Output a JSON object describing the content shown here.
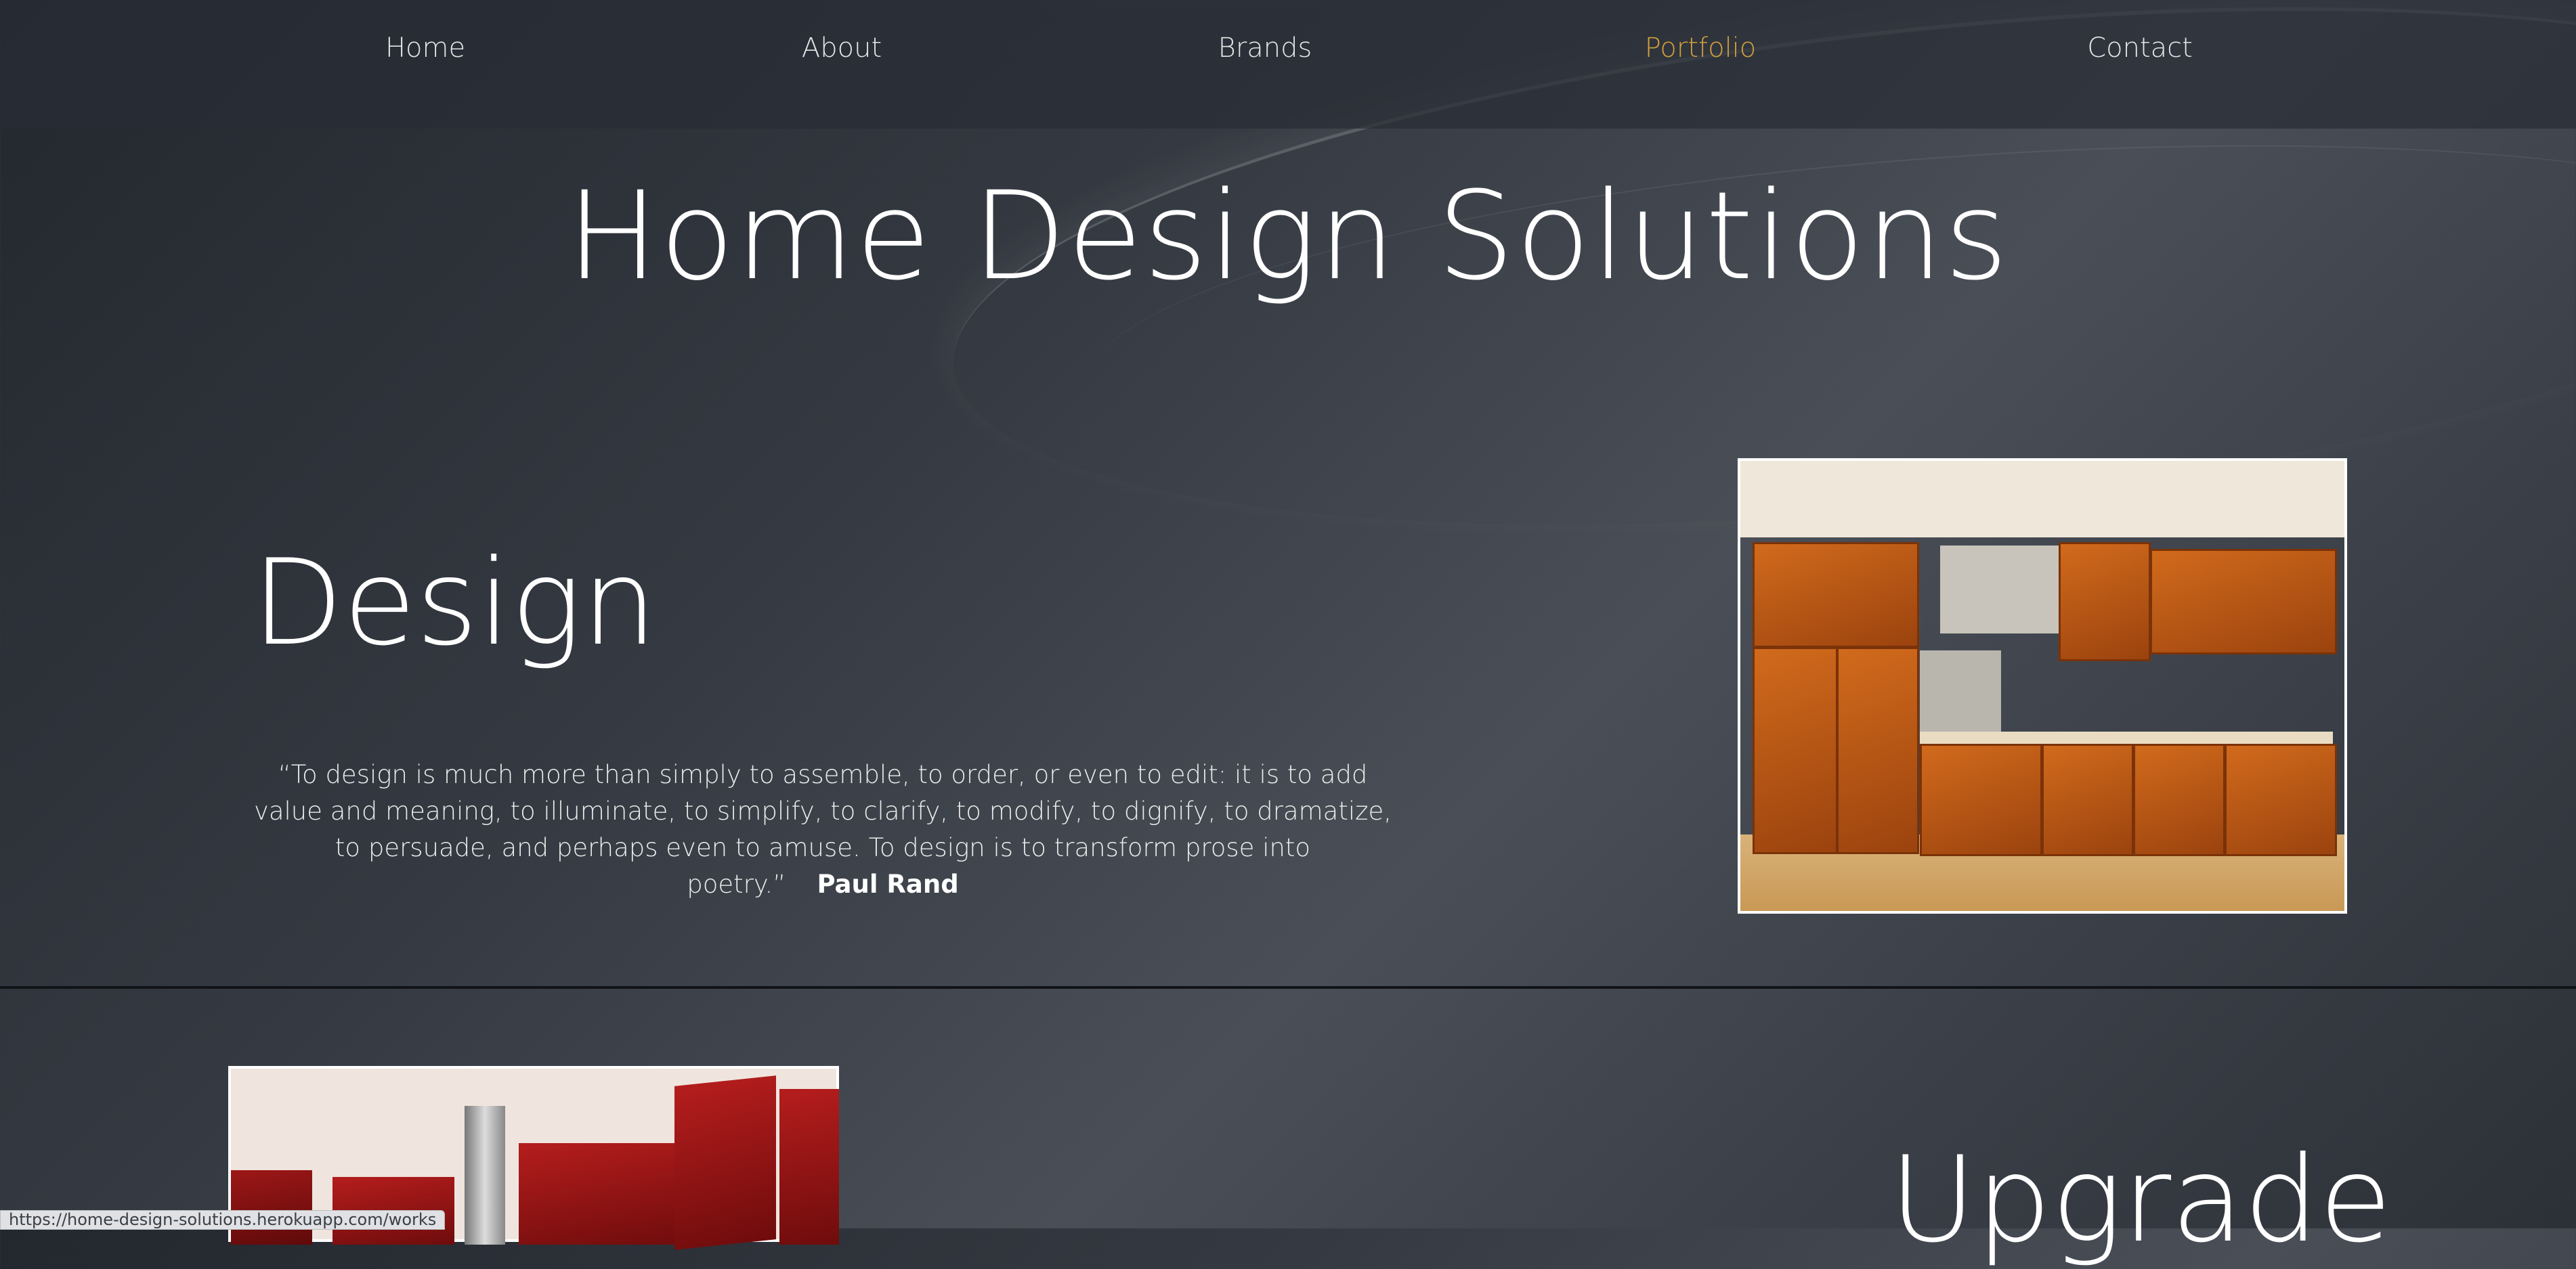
{
  "nav": {
    "items": [
      {
        "label": "Home"
      },
      {
        "label": "About"
      },
      {
        "label": "Brands"
      },
      {
        "label": "Portfolio",
        "active": true
      },
      {
        "label": "Contact"
      }
    ],
    "active_color": "#d1a03c"
  },
  "hero": {
    "title": "Home Design Solutions"
  },
  "design_section": {
    "heading": "Design",
    "quote": "“To design is much more than simply to assemble, to order, or even to edit: it is to add value and meaning, to illuminate, to simplify, to clarify, to modify, to dignify, to dramatize, to persuade, and perhaps even to amuse. To design is to transform prose into poetry.”",
    "author": "Paul Rand"
  },
  "upgrade_section": {
    "heading": "Upgrade"
  },
  "status_bar": {
    "url": "https://home-design-solutions.herokuapp.com/works"
  }
}
